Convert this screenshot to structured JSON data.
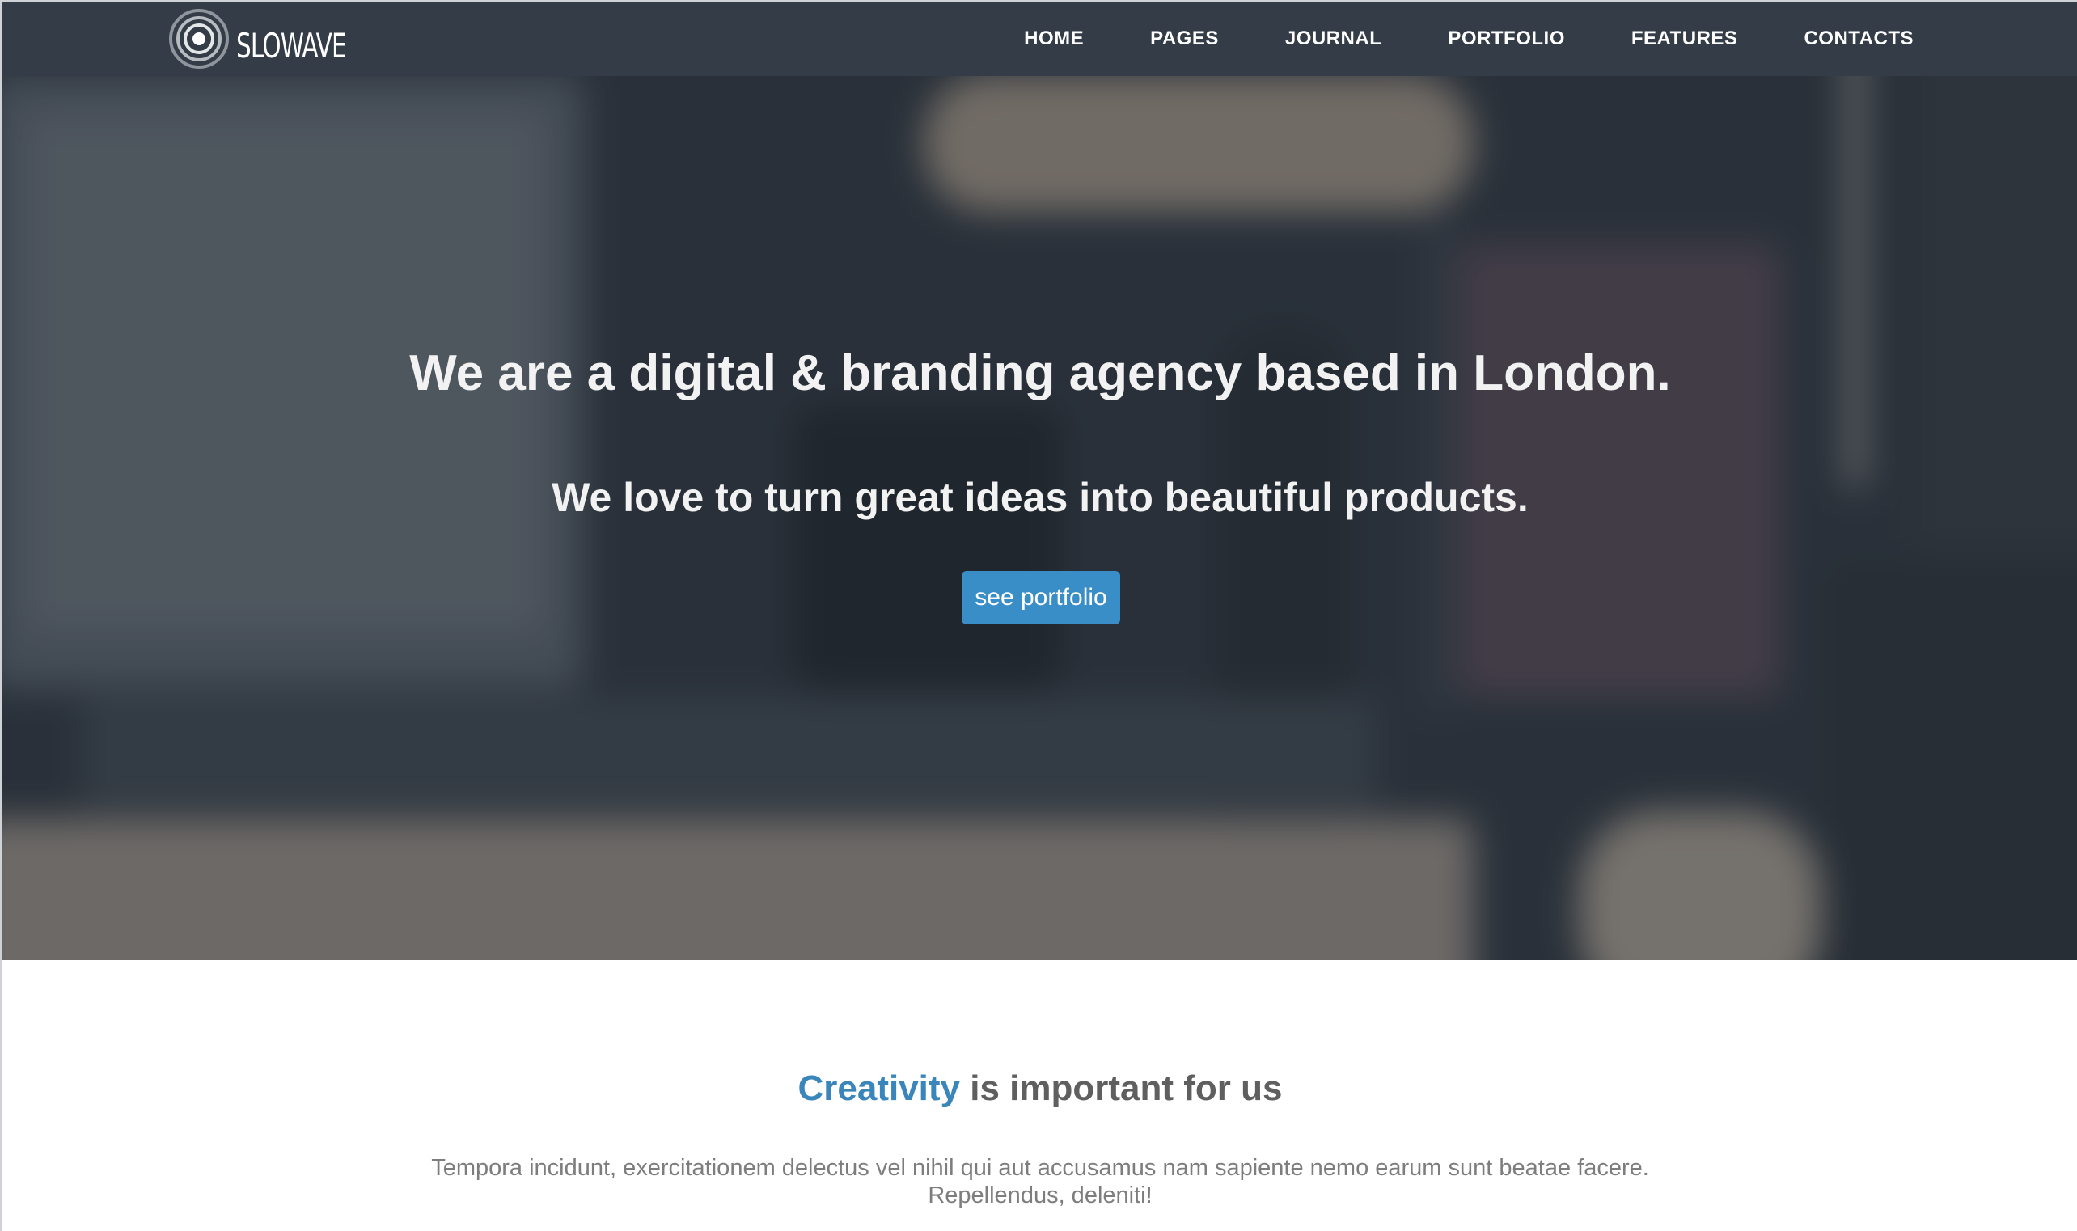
{
  "brand": {
    "name": "SLOWAVE",
    "logo_icon": "concentric-circles-icon"
  },
  "nav": {
    "items": [
      "HOME",
      "PAGES",
      "JOURNAL",
      "PORTFOLIO",
      "FEATURES",
      "CONTACTS"
    ]
  },
  "hero": {
    "title": "We are a digital & branding agency based in London.",
    "subtitle": "We love to turn great ideas into beautiful products.",
    "button_label": "see portfolio"
  },
  "about": {
    "title_accent": "Creativity",
    "title_rest": " is important for us",
    "text": "Tempora incidunt, exercitationem delectus vel nihil qui aut accusamus nam sapiente nemo earum sunt beatae facere. Repellendus, deleniti!"
  },
  "colors": {
    "navbar": "#333c47",
    "accent": "#3a8ec8",
    "heading_accent": "#3a86bb",
    "heading": "#5f5f5f",
    "body_text": "#7d7d7d"
  }
}
